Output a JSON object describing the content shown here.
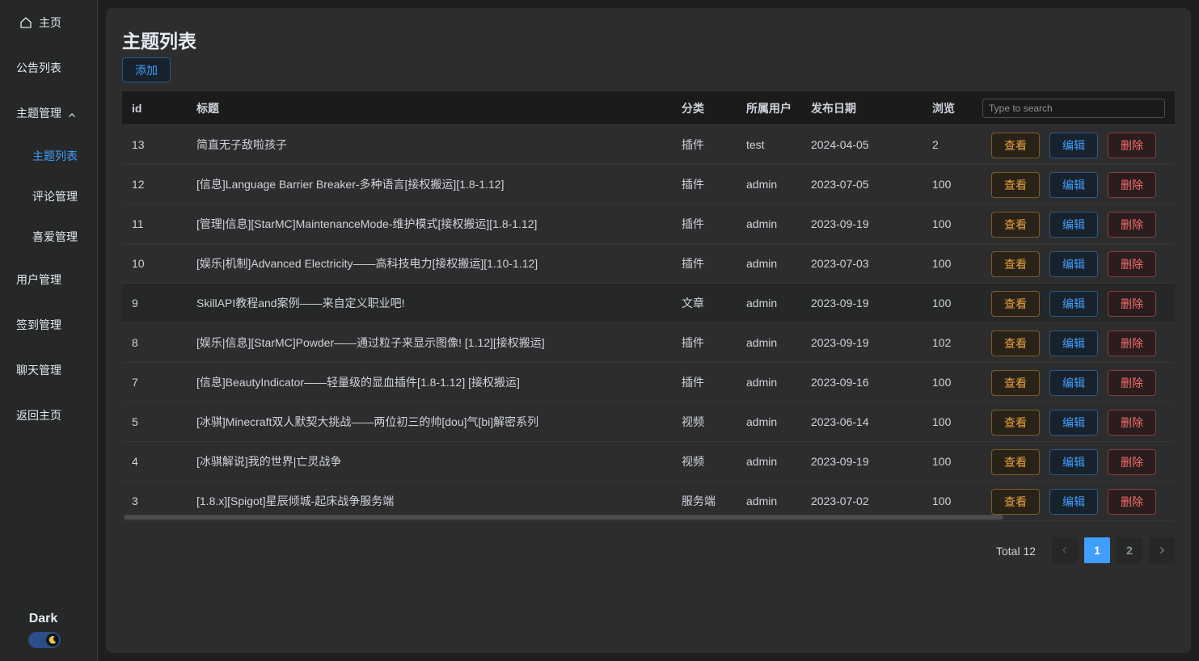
{
  "sidebar": {
    "items": [
      {
        "label": "主页"
      },
      {
        "label": "公告列表"
      },
      {
        "label": "主题管理"
      },
      {
        "label": "主题列表"
      },
      {
        "label": "评论管理"
      },
      {
        "label": "喜爱管理"
      },
      {
        "label": "用户管理"
      },
      {
        "label": "签到管理"
      },
      {
        "label": "聊天管理"
      },
      {
        "label": "返回主页"
      }
    ],
    "theme_label": "Dark",
    "theme_switch_on": true
  },
  "main": {
    "title": "主题列表",
    "add_label": "添加",
    "search_placeholder": "Type to search",
    "columns": [
      "id",
      "标题",
      "分类",
      "所属用户",
      "发布日期",
      "浏览"
    ],
    "actions": {
      "view": "查看",
      "edit": "编辑",
      "delete": "删除"
    },
    "rows": [
      {
        "id": "13",
        "title": "简直无子敌啦孩子",
        "category": "插件",
        "user": "test",
        "date": "2024-04-05",
        "views": "2"
      },
      {
        "id": "12",
        "title": "[信息]Language Barrier Breaker-多种语言[接权搬运][1.8-1.12]",
        "category": "插件",
        "user": "admin",
        "date": "2023-07-05",
        "views": "100"
      },
      {
        "id": "11",
        "title": "[管理|信息][StarMC]MaintenanceMode-维护模式[接权搬运][1.8-1.12]",
        "category": "插件",
        "user": "admin",
        "date": "2023-09-19",
        "views": "100"
      },
      {
        "id": "10",
        "title": "[娱乐|机制]Advanced Electricity——高科技电力[接权搬运][1.10-1.12]",
        "category": "插件",
        "user": "admin",
        "date": "2023-07-03",
        "views": "100"
      },
      {
        "id": "9",
        "title": "SkillAPI教程and案例——来自定义职业吧!",
        "category": "文章",
        "user": "admin",
        "date": "2023-09-19",
        "views": "100"
      },
      {
        "id": "8",
        "title": "[娱乐|信息][StarMC]Powder——通过粒子来显示图像! [1.12][接权搬运]",
        "category": "插件",
        "user": "admin",
        "date": "2023-09-19",
        "views": "102"
      },
      {
        "id": "7",
        "title": "[信息]BeautyIndicator——轻量级的显血插件[1.8-1.12] [接权搬运]",
        "category": "插件",
        "user": "admin",
        "date": "2023-09-16",
        "views": "100"
      },
      {
        "id": "5",
        "title": "[冰骐]Minecraft双人默契大挑战——两位初三的帅[dou]气[bi]解密系列",
        "category": "视频",
        "user": "admin",
        "date": "2023-06-14",
        "views": "100"
      },
      {
        "id": "4",
        "title": "[冰骐解说]我的世界|亡灵战争",
        "category": "视频",
        "user": "admin",
        "date": "2023-09-19",
        "views": "100"
      },
      {
        "id": "3",
        "title": "[1.8.x][Spigot]星辰倾城-起床战争服务端",
        "category": "服务端",
        "user": "admin",
        "date": "2023-07-02",
        "views": "100"
      }
    ],
    "pagination": {
      "total_label": "Total 12",
      "pages": [
        "1",
        "2"
      ],
      "current": "1"
    }
  },
  "colors": {
    "primary": "#409eff",
    "warning": "#e6a23c",
    "danger": "#f56c6c",
    "panel": "#2d2d2e",
    "sidebar": "#262727"
  },
  "icons": {
    "home": "home-icon",
    "chevron": "chevron-up-icon",
    "prev": "chevron-left-icon",
    "next": "chevron-right-icon",
    "moon": "moon-icon"
  }
}
